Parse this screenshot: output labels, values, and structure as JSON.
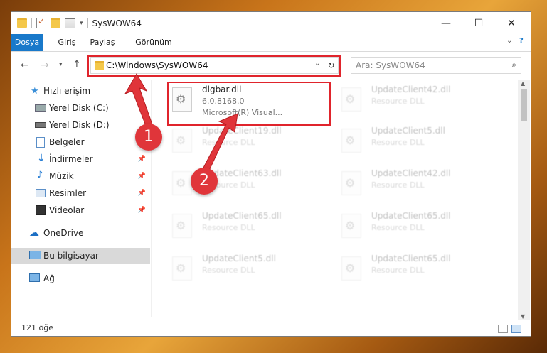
{
  "window": {
    "title": "SysWOW64",
    "controls": {
      "minimize": "—",
      "maximize": "☐",
      "close": "✕"
    }
  },
  "ribbon": {
    "tabs": [
      "Dosya",
      "Giriş",
      "Paylaş",
      "Görünüm"
    ]
  },
  "address": {
    "path": "C:\\Windows\\SysWOW64",
    "search_placeholder": "Ara: SysWOW64"
  },
  "sidebar": {
    "items": [
      {
        "label": "Hızlı erişim",
        "icon": "star-icon"
      },
      {
        "label": "Yerel Disk (C:)",
        "icon": "drive-icon"
      },
      {
        "label": "Yerel Disk (D:)",
        "icon": "drive-icon"
      },
      {
        "label": "Belgeler",
        "icon": "documents-icon"
      },
      {
        "label": "İndirmeler",
        "icon": "download-icon"
      },
      {
        "label": "Müzik",
        "icon": "music-icon"
      },
      {
        "label": "Resimler",
        "icon": "pictures-icon"
      },
      {
        "label": "Videolar",
        "icon": "video-icon"
      },
      {
        "label": "OneDrive",
        "icon": "cloud-icon"
      },
      {
        "label": "Bu bilgisayar",
        "icon": "computer-icon"
      },
      {
        "label": "Ağ",
        "icon": "network-icon"
      }
    ]
  },
  "files": [
    {
      "name": "dlgbar.dll",
      "line1": "6.0.8168.0",
      "line2": "Microsoft(R) Visual...",
      "selected": true
    },
    {
      "name": "UpdateClient42.dll",
      "line1": "Resource DLL"
    },
    {
      "name": "UpdateClient19.dll",
      "line1": "Resource DLL"
    },
    {
      "name": "UpdateClient5.dll",
      "line1": "Resource DLL"
    },
    {
      "name": "UpdateClient63.dll",
      "line1": "Resource DLL"
    },
    {
      "name": "UpdateClient42.dll",
      "line1": "Resource DLL"
    },
    {
      "name": "UpdateClient65.dll",
      "line1": "Resource DLL"
    },
    {
      "name": "UpdateClient65.dll",
      "line1": "Resource DLL"
    },
    {
      "name": "UpdateClient5.dll",
      "line1": "Resource DLL"
    },
    {
      "name": "UpdateClient65.dll",
      "line1": "Resource DLL"
    }
  ],
  "status": {
    "count": "121 öğe"
  },
  "annotations": {
    "badge1": "1",
    "badge2": "2"
  },
  "colors": {
    "accent": "#1979ca",
    "highlight": "#e0242c",
    "badge": "#e0353a"
  }
}
